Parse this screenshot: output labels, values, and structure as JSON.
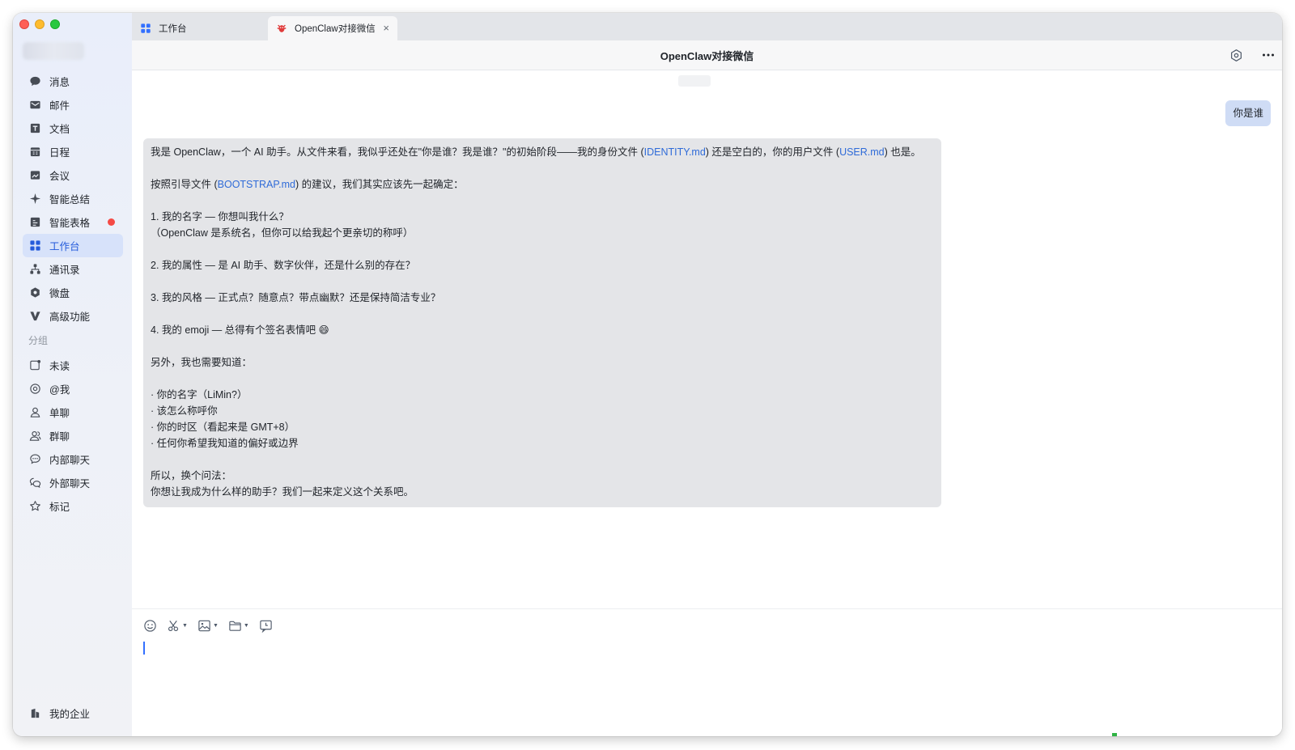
{
  "sidebar": {
    "items": [
      {
        "id": "messages",
        "label": "消息",
        "icon": "chat-bubble-icon"
      },
      {
        "id": "mail",
        "label": "邮件",
        "icon": "mail-icon"
      },
      {
        "id": "docs",
        "label": "文档",
        "icon": "document-icon"
      },
      {
        "id": "calendar",
        "label": "日程",
        "icon": "calendar-icon"
      },
      {
        "id": "meeting",
        "label": "会议",
        "icon": "meeting-icon"
      },
      {
        "id": "ai-summary",
        "label": "智能总结",
        "icon": "sparkle-icon"
      },
      {
        "id": "smart-sheet",
        "label": "智能表格",
        "icon": "sheet-icon"
      },
      {
        "id": "workbench",
        "label": "工作台",
        "icon": "grid-icon"
      },
      {
        "id": "contacts",
        "label": "通讯录",
        "icon": "org-chart-icon"
      },
      {
        "id": "weidisk",
        "label": "微盘",
        "icon": "disk-icon"
      },
      {
        "id": "advanced",
        "label": "高级功能",
        "icon": "v-logo-icon"
      }
    ],
    "group_label": "分组",
    "group_items": [
      {
        "id": "unread",
        "label": "未读",
        "icon": "unread-icon"
      },
      {
        "id": "mentions",
        "label": "@我",
        "icon": "at-icon"
      },
      {
        "id": "single-chat",
        "label": "单聊",
        "icon": "person-icon"
      },
      {
        "id": "group-chat",
        "label": "群聊",
        "icon": "people-icon"
      },
      {
        "id": "internal-chat",
        "label": "内部聊天",
        "icon": "chat-dots-icon"
      },
      {
        "id": "external-chat",
        "label": "外部聊天",
        "icon": "chat-double-icon"
      },
      {
        "id": "starred",
        "label": "标记",
        "icon": "star-icon"
      }
    ],
    "bottom": {
      "label": "我的企业",
      "icon": "building-icon"
    }
  },
  "tabs": [
    {
      "label": "工作台",
      "icon": "grid-icon"
    },
    {
      "label": "OpenClaw对接微信",
      "icon": "lobster-icon",
      "close": "×"
    }
  ],
  "header": {
    "title": "OpenClaw对接微信"
  },
  "chat": {
    "me_message": "你是谁",
    "bot_lines": [
      {
        "parts": [
          "我是 OpenClaw，一个 AI 助手。从文件来看，我似乎还处在\"你是谁？我是谁？\"的初始阶段——我的身份文件 (",
          "IDENTITY.md",
          ") 还是空白的，你的用户文件 (",
          "USER.md",
          ") 也是。"
        ]
      },
      {
        "parts": [
          ""
        ]
      },
      {
        "parts": [
          "按照引导文件 (",
          "BOOTSTRAP.md",
          ") 的建议，我们其实应该先一起确定："
        ]
      },
      {
        "parts": [
          ""
        ]
      },
      {
        "parts": [
          "1. 我的名字 — 你想叫我什么？"
        ]
      },
      {
        "parts": [
          "（OpenClaw 是系统名，但你可以给我起个更亲切的称呼）"
        ]
      },
      {
        "parts": [
          ""
        ]
      },
      {
        "parts": [
          "2. 我的属性 — 是 AI 助手、数字伙伴，还是什么别的存在？"
        ]
      },
      {
        "parts": [
          ""
        ]
      },
      {
        "parts": [
          "3. 我的风格 — 正式点？随意点？带点幽默？还是保持简洁专业？"
        ]
      },
      {
        "parts": [
          ""
        ]
      },
      {
        "parts": [
          "4. 我的 emoji — 总得有个签名表情吧 😄"
        ]
      },
      {
        "parts": [
          ""
        ]
      },
      {
        "parts": [
          "另外，我也需要知道："
        ]
      },
      {
        "parts": [
          ""
        ]
      },
      {
        "parts": [
          "· 你的名字（LiMin?）"
        ]
      },
      {
        "parts": [
          "· 该怎么称呼你"
        ]
      },
      {
        "parts": [
          "· 你的时区（看起来是 GMT+8）"
        ]
      },
      {
        "parts": [
          "· 任何你希望我知道的偏好或边界"
        ]
      },
      {
        "parts": [
          ""
        ]
      },
      {
        "parts": [
          "所以，换个问法："
        ]
      },
      {
        "parts": [
          "你想让我成为什么样的助手？我们一起来定义这个关系吧。"
        ]
      }
    ]
  },
  "composer": {
    "tools": [
      "emoji-icon",
      "scissors-icon",
      "image-icon",
      "folder-icon",
      "chat-history-icon"
    ]
  },
  "colors": {
    "accent": "#245bdb",
    "link": "#2f6bd8",
    "active_bg": "#d7e2fa",
    "badge": "#f54a45"
  }
}
